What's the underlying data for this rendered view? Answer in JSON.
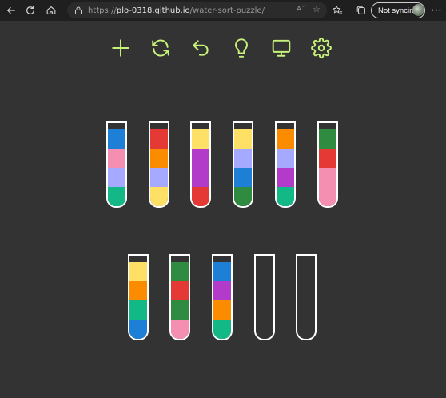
{
  "browser": {
    "url_scheme": "https://",
    "url_host": "plo-0318.github.io",
    "url_path": "/water-sort-puzzle/",
    "sync_label": "Not syncing"
  },
  "toolbar": {
    "buttons": [
      {
        "name": "new-game-button",
        "icon": "plus-icon"
      },
      {
        "name": "restart-button",
        "icon": "refresh-icon"
      },
      {
        "name": "undo-button",
        "icon": "undo-icon"
      },
      {
        "name": "hint-button",
        "icon": "lightbulb-icon"
      },
      {
        "name": "display-button",
        "icon": "monitor-icon"
      },
      {
        "name": "settings-button",
        "icon": "gear-icon"
      }
    ],
    "accent_color": "#c7f27a"
  },
  "game": {
    "tube_capacity": 4,
    "colors": {
      "blue": "#1e7fd6",
      "pink": "#f48fb1",
      "lavender": "#a5a9ff",
      "teal": "#12b886",
      "red": "#e53935",
      "orange": "#fb8c00",
      "yellow": "#ffe066",
      "purple": "#b23cc9",
      "green": "#2e8b40"
    },
    "tubes": [
      [
        "blue",
        "pink",
        "lavender",
        "teal"
      ],
      [
        "red",
        "orange",
        "lavender",
        "yellow"
      ],
      [
        "yellow",
        "purple",
        "purple",
        "red"
      ],
      [
        "yellow",
        "lavender",
        "blue",
        "green"
      ],
      [
        "orange",
        "lavender",
        "purple",
        "teal"
      ],
      [
        "green",
        "red",
        "pink",
        "pink"
      ],
      [
        "yellow",
        "orange",
        "teal",
        "blue"
      ],
      [
        "green",
        "red",
        "green",
        "pink"
      ],
      [
        "blue",
        "purple",
        "orange",
        "teal"
      ],
      [],
      []
    ]
  }
}
